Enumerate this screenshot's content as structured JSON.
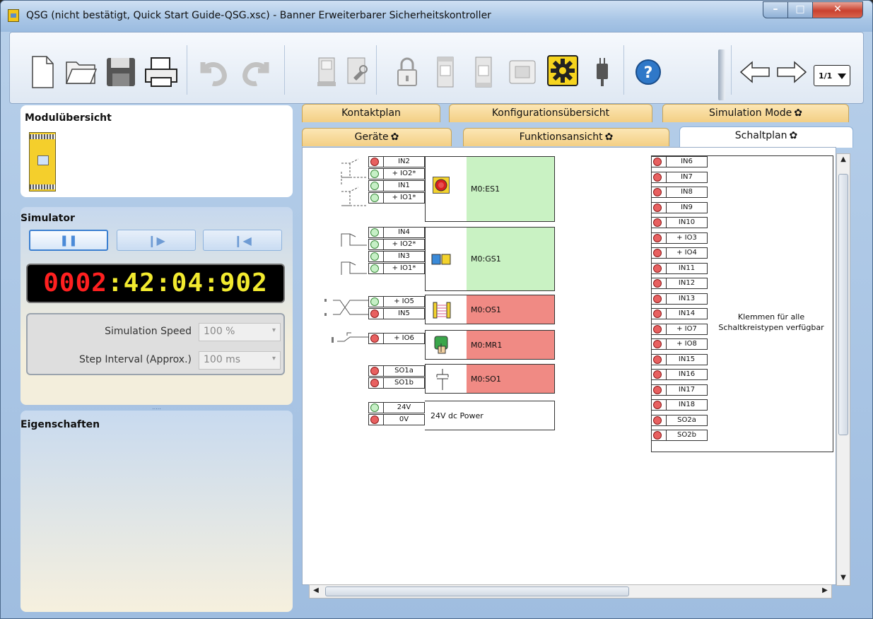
{
  "window": {
    "title": "QSG (nicht bestätigt, Quick Start Guide-QSG.xsc) - Banner Erweiterbarer Sicherheitskontroller",
    "minimize": "–",
    "maximize": "□",
    "close": "✕"
  },
  "toolbar": {
    "pager": "1/1",
    "icons": [
      "new-file",
      "open-folder",
      "save",
      "print",
      "undo",
      "redo",
      "device",
      "configure-device",
      "lock",
      "module-a",
      "module-b",
      "chip",
      "settings-gear",
      "usb-plug",
      "help",
      "nav-back",
      "nav-forward"
    ]
  },
  "module_overview": {
    "title": "Modulübersicht"
  },
  "simulator": {
    "title": "Simulator",
    "clock": {
      "days": "0002",
      "sep1": ":",
      "hours": "42",
      "sep2": ":",
      "minutes": "04",
      "sep3": ":",
      "ms": "902"
    },
    "speed_label": "Simulation Speed",
    "speed_value": "100 %",
    "interval_label": "Step Interval (Approx.)",
    "interval_value": "100 ms",
    "splitter_dots": "....."
  },
  "properties": {
    "title": "Eigenschaften"
  },
  "tabs": {
    "kontaktplan": "Kontaktplan",
    "konfig": "Konfigurationsübersicht",
    "simulation": "Simulation Mode",
    "geraete": "Geräte",
    "funktion": "Funktionsansicht",
    "schaltplan": "Schaltplan",
    "gear_glyph": "✿"
  },
  "diagram": {
    "es1": {
      "terms": [
        "IN2",
        "+ IO2*",
        "IN1",
        "+ IO1*"
      ],
      "label": "M0:ES1"
    },
    "gs1": {
      "terms": [
        "IN4",
        "+ IO2*",
        "IN3",
        "+ IO1*"
      ],
      "label": "M0:GS1"
    },
    "os1": {
      "terms": [
        "+ IO5",
        "IN5"
      ],
      "label": "M0:OS1"
    },
    "mr1": {
      "terms": [
        "+ IO6"
      ],
      "label": "M0:MR1"
    },
    "so1": {
      "terms": [
        "SO1a",
        "SO1b"
      ],
      "label": "M0:SO1"
    },
    "power": {
      "terms": [
        "24V",
        "0V"
      ],
      "label": "24V dc Power"
    },
    "right_terms": [
      "IN6",
      "IN7",
      "IN8",
      "IN9",
      "IN10",
      "+ IO3",
      "+ IO4",
      "IN11",
      "IN12",
      "IN13",
      "IN14",
      "+ IO7",
      "+ IO8",
      "IN15",
      "IN16",
      "IN17",
      "IN18",
      "SO2a",
      "SO2b"
    ],
    "right_text": "Klemmen für alle Schaltkreistypen verfügbar"
  },
  "colors": {
    "green_block": "#c9f2c3",
    "red_block": "#f08a84",
    "clock_red": "#ff2020",
    "clock_yellow": "#f2ea2f"
  }
}
